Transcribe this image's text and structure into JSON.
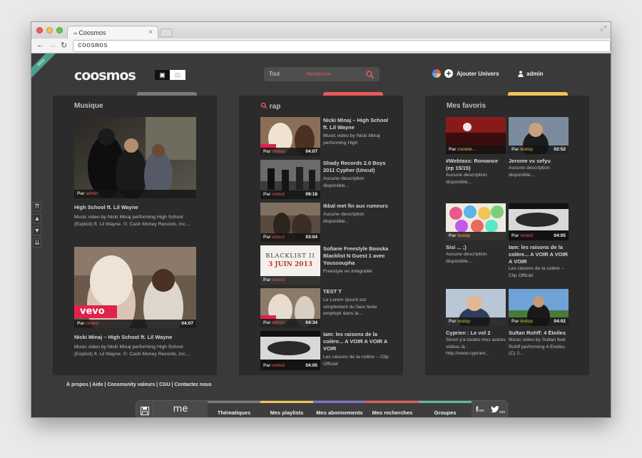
{
  "browser": {
    "tab_title": "Coosmos",
    "tab_close": "×",
    "url": "coosmos",
    "back": "←",
    "forward": "→",
    "reload": "↻"
  },
  "colors": {
    "accent_red": "#e85a5a",
    "panel_bg": "#2b2b2b",
    "page_bg": "#3a3a3a",
    "tab_gray": "#7a7a7a",
    "tab_red": "#e85a5a",
    "tab_yellow": "#f3c45a",
    "tab_purple": "#8272c8",
    "tab_teal": "#5fb8a0"
  },
  "header": {
    "beta": "beta",
    "logo": "coosmos",
    "search_scope": "Tout",
    "search_placeholder": "Recherche",
    "add_universe": "Ajouter Univers",
    "user": "admin"
  },
  "panels": {
    "musique": {
      "title": "Musique",
      "items": [
        {
          "by": "Par",
          "user": "admin",
          "duration": "",
          "title": "High School ft. Lil Wayne",
          "desc": "Music video by Nicki Minaj performing High School (Explicit) ft. Lil Wayne. ©: Cash Money Records, Inc...."
        },
        {
          "by": "Par",
          "user": "ontest",
          "duration": "04:07",
          "title": "Nicki Minaj – High School ft. Lil Wayne",
          "desc": "Music video by Nicki Minaj performing High School (Explicit) ft. Lil Wayne. ©: Cash Money Records, Inc....",
          "badge": "vevo"
        }
      ]
    },
    "rap": {
      "title": "rap",
      "items": [
        {
          "by": "Par",
          "user": "ontest",
          "duration": "04:07",
          "title": "Nicki Minaj – High School ft. Lil Wayne",
          "desc": "Music video by Nicki Minaj performing High"
        },
        {
          "by": "Par",
          "user": "ontest",
          "duration": "09:18",
          "title": "Shady Records 2.0 Boys 2011 Cypher (Uncut)",
          "desc": "Aucune description disponible..."
        },
        {
          "by": "Par",
          "user": "ontest",
          "duration": "03:04",
          "title": "Ikbal met fin aux rumeurs",
          "desc": "Aucune description disponible..."
        },
        {
          "by": "Par",
          "user": "ontest",
          "duration": "",
          "title": "Sofiane Freestyle Booska Blacklist N Guest 1 avec Youssoupha",
          "desc": "Freestyle en intégralité",
          "poster_top": "BLACKLIST II",
          "poster_date": "3 JUIN 2013"
        },
        {
          "by": "Par",
          "user": "admin",
          "duration": "04:34",
          "title": "TEST T",
          "desc": "Le Lorem Ipsum est simplement du faux texte employé dans la..."
        },
        {
          "by": "Par",
          "user": "ontest",
          "duration": "04:05",
          "title": "Iam: les raisons de la colère... A VOIR A VOIR A VOIR",
          "desc": "Les raisons de la colère -- Clip Officiel"
        }
      ]
    },
    "favoris": {
      "title": "Mes favoris",
      "items": [
        {
          "by": "Par",
          "user": "coowte...",
          "duration": "",
          "title": "#Webtaxs: Romance (ep 15/15)",
          "desc": "Aucune description disponible..."
        },
        {
          "by": "Par",
          "user": "testop",
          "duration": "02:52",
          "title": "Jerome vs sefyu",
          "desc": "Aucune description disponible..."
        },
        {
          "by": "Par",
          "user": "testop",
          "duration": "",
          "title": "Sisi ... ;)",
          "desc": "Aucune description disponible..."
        },
        {
          "by": "Par",
          "user": "ontest",
          "duration": "04:05",
          "title": "Iam: les raisons de la colère... A VOIR A VOIR A VOIR",
          "desc": "Les raisons de la colère -- Clip Officiel"
        },
        {
          "by": "Par",
          "user": "testop",
          "duration": "",
          "title": "Cyprien : Le vol 2",
          "desc": "Sinon y'a toutes mes autres vidéos là : http://www.cyprien..."
        },
        {
          "by": "Par",
          "user": "testop",
          "duration": "04:02",
          "title": "Sultan Rohff: 4 Étoiles",
          "desc": "Music video by Sultan feat Rohff performing 4 Etoiles. (C) 2..."
        }
      ]
    }
  },
  "footer": {
    "links": "À propos | Aide | Coosmunity valeurs | CGU | Contactez nous"
  },
  "bottom_bar": {
    "me": "me",
    "tabs": [
      "Thématiques",
      "Mes playlists",
      "Mes abonnements",
      "Mes recherches",
      "Groupes"
    ],
    "facebook": "f",
    "twitter": "t",
    "social_sub": "coo"
  }
}
